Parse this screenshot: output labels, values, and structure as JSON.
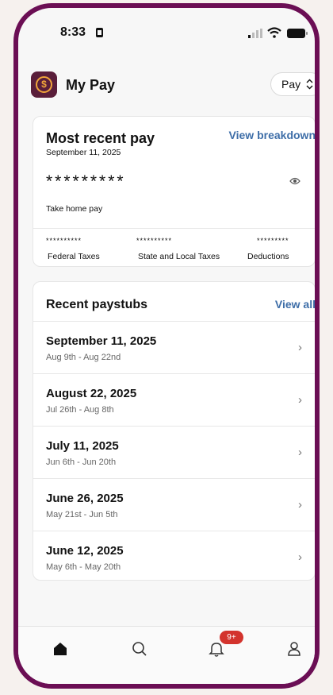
{
  "status_bar": {
    "time": "8:33"
  },
  "header": {
    "title": "My Pay",
    "pay_select": "Pay"
  },
  "most_recent_pay": {
    "title": "Most recent pay",
    "date": "September 11, 2025",
    "link": "View breakdown",
    "masked_amount": "*********",
    "amount_label": "Take home pay",
    "taxes": [
      {
        "mask": "**********",
        "label": "Federal Taxes"
      },
      {
        "mask": "**********",
        "label": "State and Local Taxes"
      },
      {
        "mask": "*********",
        "label": "Deductions"
      }
    ]
  },
  "recent_paystubs": {
    "title": "Recent paystubs",
    "link": "View all",
    "items": [
      {
        "date": "September 11, 2025",
        "range": "Aug 9th - Aug 22nd"
      },
      {
        "date": "August 22, 2025",
        "range": "Jul 26th - Aug 8th"
      },
      {
        "date": "July 11, 2025",
        "range": "Jun 6th - Jun 20th"
      },
      {
        "date": "June 26, 2025",
        "range": "May 21st - Jun 5th"
      },
      {
        "date": "June 12, 2025",
        "range": "May 6th - May 20th"
      }
    ]
  },
  "bottom_nav": {
    "items": [
      "home-icon",
      "search-icon",
      "bell-icon",
      "person-icon"
    ],
    "notification_badge": "9+"
  },
  "colors": {
    "frame": "#6b0e54",
    "link": "#3e6ea8",
    "badge": "#d3332d",
    "logo_bg": "#5a1e3a",
    "coin": "#f0a43a"
  }
}
